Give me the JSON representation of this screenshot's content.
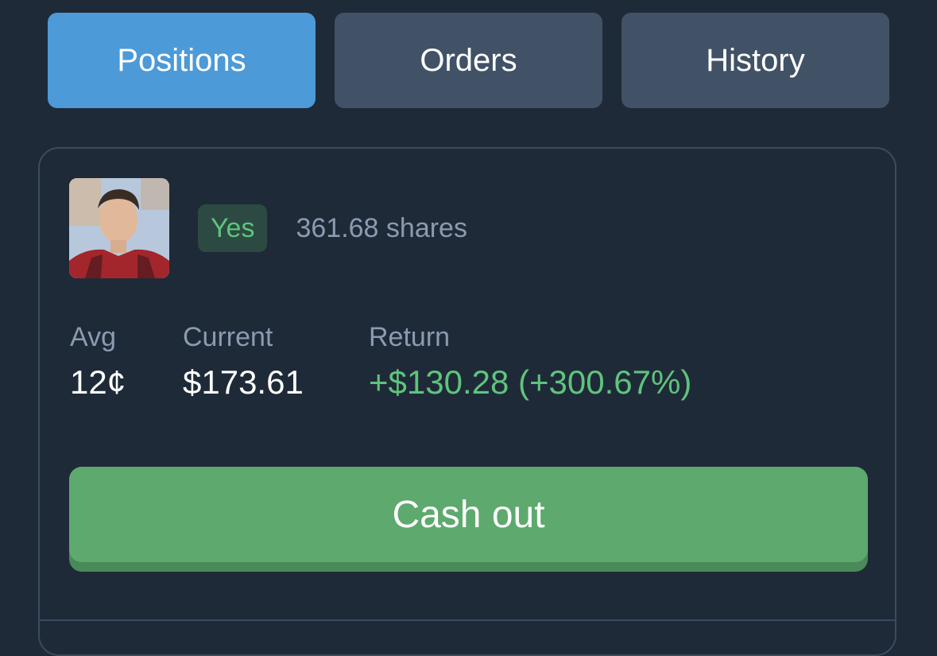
{
  "tabs": [
    {
      "label": "Positions",
      "active": true
    },
    {
      "label": "Orders",
      "active": false
    },
    {
      "label": "History",
      "active": false
    }
  ],
  "position": {
    "outcome": "Yes",
    "shares": "361.68 shares",
    "stats": {
      "avg": {
        "label": "Avg",
        "value": "12¢"
      },
      "current": {
        "label": "Current",
        "value": "$173.61"
      },
      "return": {
        "label": "Return",
        "value": "+$130.28 (+300.67%)"
      }
    },
    "cashout_label": "Cash out"
  },
  "colors": {
    "background": "#1f2a38",
    "active_tab": "#4c9ad8",
    "inactive_tab": "#415266",
    "positive": "#5ec47d",
    "cashout": "#5ea96e"
  }
}
